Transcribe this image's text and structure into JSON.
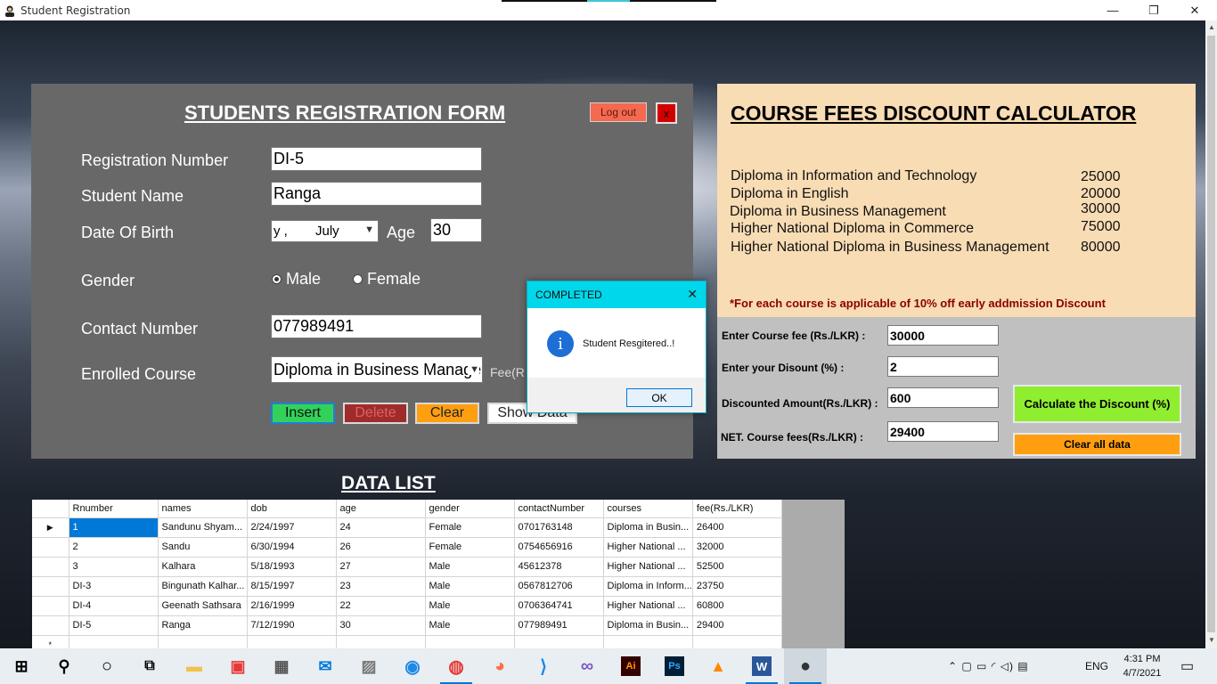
{
  "window": {
    "title": "Student Registration",
    "minimize": "—",
    "restore": "❐",
    "close": "✕"
  },
  "registration": {
    "title": "STUDENTS REGISTRATION FORM",
    "logout_label": "Log out",
    "close_label": "x",
    "labels": {
      "reg_no": "Registration Number",
      "name": "Student Name",
      "dob": "Date Of Birth",
      "age": "Age",
      "gender": "Gender",
      "contact": "Contact Number",
      "course": "Enrolled Course",
      "fee": "Fee(R"
    },
    "values": {
      "reg_no": "DI-5",
      "name": "Ranga",
      "dob_part1": "y ,",
      "dob_part2": "July",
      "age": "30",
      "contact": "077989491",
      "course": "Diploma in Business Management"
    },
    "gender_options": [
      "Male",
      "Female"
    ],
    "gender_selected": "Male",
    "buttons": {
      "insert": "Insert",
      "delete": "Delete",
      "clear": "Clear",
      "show": "Show Data"
    }
  },
  "discount": {
    "title": "COURSE FEES DISCOUNT CALCULATOR",
    "courses": [
      {
        "name": "Diploma in Information and Technology",
        "fee": "25000"
      },
      {
        "name": "Diploma in English",
        "fee": "20000"
      },
      {
        "name": "Diploma in Business Management",
        "fee": "30000"
      },
      {
        "name": "Higher National Diploma in Commerce",
        "fee": "75000"
      },
      {
        "name": "Higher National Diploma in Business Management",
        "fee": "80000"
      }
    ],
    "note": "*For each course is applicable of 10% off early addmission Discount",
    "labels": {
      "course_fee": "Enter Course fee (Rs./LKR) :",
      "discount_pct": "Enter your Disount (%) :",
      "discounted_amount": "Discounted Amount(Rs./LKR) :",
      "net_fee": "NET. Course fees(Rs./LKR) :"
    },
    "values": {
      "course_fee": "30000",
      "discount_pct": "2",
      "discounted_amount": "600",
      "net_fee": "29400"
    },
    "calc_button": "Calculate the Discount (%)",
    "clear_button": "Clear all data"
  },
  "data_list": {
    "title": "DATA LIST",
    "columns": [
      "Rnumber",
      "names",
      "dob",
      "age",
      "gender",
      "contactNumber",
      "courses",
      "fee(Rs./LKR)"
    ],
    "rows": [
      [
        "1",
        "Sandunu Shyam...",
        "2/24/1997",
        "24",
        "Female",
        "0701763148",
        "Diploma in Busin...",
        "26400"
      ],
      [
        "2",
        "Sandu",
        "6/30/1994",
        "26",
        "Female",
        "0754656916",
        "Higher National ...",
        "32000"
      ],
      [
        "3",
        "Kalhara",
        "5/18/1993",
        "27",
        "Male",
        "45612378",
        "Higher National ...",
        "52500"
      ],
      [
        "DI-3",
        "Bingunath Kalhar...",
        "8/15/1997",
        "23",
        "Male",
        "0567812706",
        "Diploma in Inform...",
        "23750"
      ],
      [
        "DI-4",
        "Geenath Sathsara",
        "2/16/1999",
        "22",
        "Male",
        "0706364741",
        "Higher National ...",
        "60800"
      ],
      [
        "DI-5",
        "Ranga",
        "7/12/1990",
        "30",
        "Male",
        "077989491",
        "Diploma in Busin...",
        "29400"
      ]
    ],
    "current_row_marker": "▶",
    "new_row_marker": "*"
  },
  "dialog": {
    "title": "COMPLETED",
    "message": "Student Resgitered..!",
    "ok_label": "OK",
    "close_label": "✕",
    "icon_glyph": "i"
  },
  "taskbar": {
    "apps": [
      {
        "name": "start",
        "glyph": "⊞",
        "color": "#000000"
      },
      {
        "name": "search",
        "glyph": "⚲",
        "color": "#000000"
      },
      {
        "name": "cortana",
        "glyph": "○",
        "color": "#000000"
      },
      {
        "name": "task-view",
        "glyph": "⧉",
        "color": "#000000"
      },
      {
        "name": "file-explorer",
        "glyph": "▬",
        "color": "#f2c14e"
      },
      {
        "name": "gift",
        "glyph": "▣",
        "color": "#e53935"
      },
      {
        "name": "store",
        "glyph": "▦",
        "color": "#555555"
      },
      {
        "name": "mail",
        "glyph": "✉",
        "color": "#0078d7"
      },
      {
        "name": "photos",
        "glyph": "▨",
        "color": "#777777"
      },
      {
        "name": "edge",
        "glyph": "◉",
        "color": "#1e88e5"
      },
      {
        "name": "chrome",
        "glyph": "◍",
        "color": "#e53935"
      },
      {
        "name": "firefox",
        "glyph": "◕",
        "color": "#ff7043"
      },
      {
        "name": "vscode",
        "glyph": "⟩",
        "color": "#1e88e5"
      },
      {
        "name": "visual-studio",
        "glyph": "∞",
        "color": "#7e57c2"
      },
      {
        "name": "illustrator",
        "glyph": "Ai",
        "color": "#ff9a00"
      },
      {
        "name": "photoshop",
        "glyph": "Ps",
        "color": "#31a8ff"
      },
      {
        "name": "vlc",
        "glyph": "▲",
        "color": "#ff8800"
      },
      {
        "name": "word",
        "glyph": "W",
        "color": "#2b579a"
      },
      {
        "name": "student-app",
        "glyph": "●",
        "color": "#333333"
      }
    ],
    "tray_language": "ENG",
    "tray_icons": "⌃  ▢  ▭  ◜  ◁)  ▤",
    "time": "4:31 PM",
    "date": "4/7/2021",
    "notification_glyph": "▭"
  }
}
